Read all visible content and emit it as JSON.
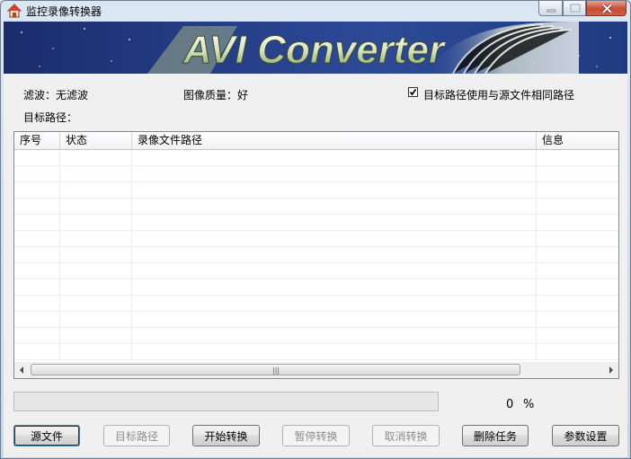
{
  "window": {
    "title": "监控录像转换器"
  },
  "banner": {
    "text": "AVI Converter"
  },
  "settings": {
    "filter_label": "滤波：",
    "filter_value": "无滤波",
    "quality_label": "图像质量：",
    "quality_value": "好",
    "same_path_label": "目标路径使用与源文件相同路径",
    "same_path_checked": true,
    "target_path_label": "目标路径："
  },
  "table": {
    "columns": [
      "序号",
      "状态",
      "录像文件路径",
      "信息"
    ],
    "rows": []
  },
  "progress": {
    "value": "0",
    "unit": "%",
    "fraction": 0
  },
  "buttons": {
    "source_file": "源文件",
    "target_path": "目标路径",
    "start_convert": "开始转换",
    "pause_convert": "暂停转换",
    "cancel_convert": "取消转换",
    "delete_task": "删除任务",
    "settings": "参数设置"
  },
  "colors": {
    "progress_green": "#06b025",
    "close_red": "#c74c35"
  }
}
